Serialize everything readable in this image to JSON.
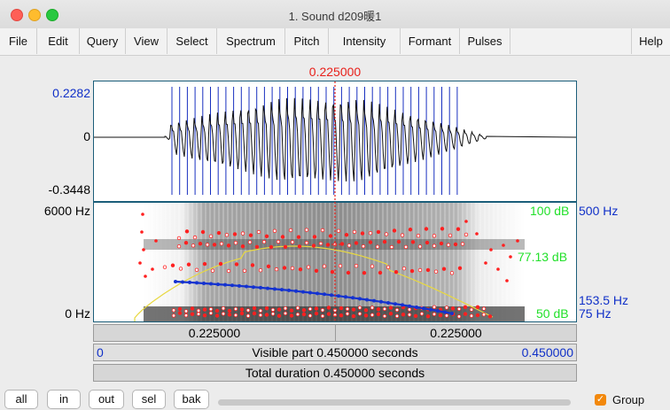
{
  "window": {
    "title": "1. Sound d209暖1"
  },
  "menu": [
    "File",
    "Edit",
    "Query",
    "View",
    "Select",
    "Spectrum",
    "Pitch",
    "Intensity",
    "Formant",
    "Pulses",
    "Help"
  ],
  "cursor": {
    "time_label": "0.225000"
  },
  "waveform": {
    "y_max": "0.2282",
    "y_zero": "0",
    "y_min": "-0.3448"
  },
  "spectrogram": {
    "freq_top": "6000 Hz",
    "freq_bottom": "0 Hz",
    "intensity_top": "100 dB",
    "intensity_mid": "77.13 dB",
    "intensity_bottom": "50 dB",
    "pitch_top": "500 Hz",
    "pitch_mid": "153.5 Hz",
    "pitch_bottom": "75 Hz"
  },
  "time_bars": {
    "left_segment": "0.225000",
    "right_segment": "0.225000",
    "visible_start": "0",
    "visible_label": "Visible part 0.450000 seconds",
    "visible_end": "0.450000",
    "total_label": "Total duration 0.450000 seconds"
  },
  "buttons": [
    "all",
    "in",
    "out",
    "sel",
    "bak"
  ],
  "group": {
    "label": "Group",
    "checked": true
  },
  "colors": {
    "pitch": "#1432d0",
    "intensity": "#22e02a",
    "formant": "#ff2020",
    "cursor": "#e8201a",
    "axis_blue": "#1030c8"
  }
}
